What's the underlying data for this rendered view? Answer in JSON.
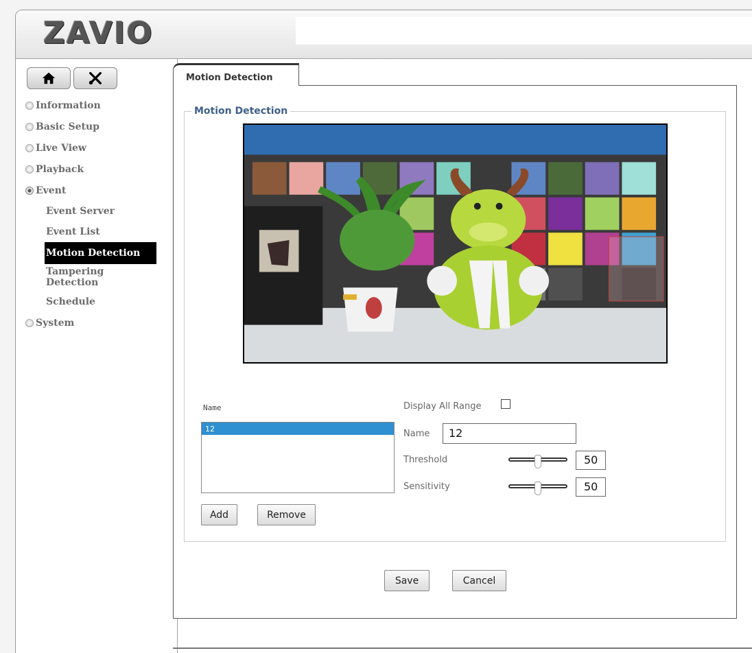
{
  "header": {
    "logo_text": "ZAVIO"
  },
  "sidebar": {
    "home_icon": "home-icon",
    "settings_icon": "tools-icon",
    "items": [
      {
        "label": "Information"
      },
      {
        "label": "Basic Setup"
      },
      {
        "label": "Live View"
      },
      {
        "label": "Playback"
      },
      {
        "label": "Event"
      },
      {
        "label": "System"
      }
    ],
    "event_sub": [
      {
        "label": "Event Server"
      },
      {
        "label": "Event List"
      },
      {
        "label": "Motion Detection"
      },
      {
        "label": "Tampering Detection"
      },
      {
        "label": "Schedule"
      }
    ],
    "active_color": "#000000"
  },
  "main": {
    "tab_label": "Motion Detection",
    "legend": "Motion Detection",
    "list_header": "Name",
    "list_items": [
      "12"
    ],
    "add_label": "Add",
    "remove_label": "Remove",
    "display_all_label": "Display All Range",
    "display_all_checked": false,
    "name_label": "Name",
    "name_value": "12",
    "threshold_label": "Threshold",
    "threshold_value": "50",
    "sensitivity_label": "Sensitivity",
    "sensitivity_value": "50",
    "save_label": "Save",
    "cancel_label": "Cancel",
    "selected_color": "#2e8fd1",
    "legend_color": "#3e5f8a"
  }
}
